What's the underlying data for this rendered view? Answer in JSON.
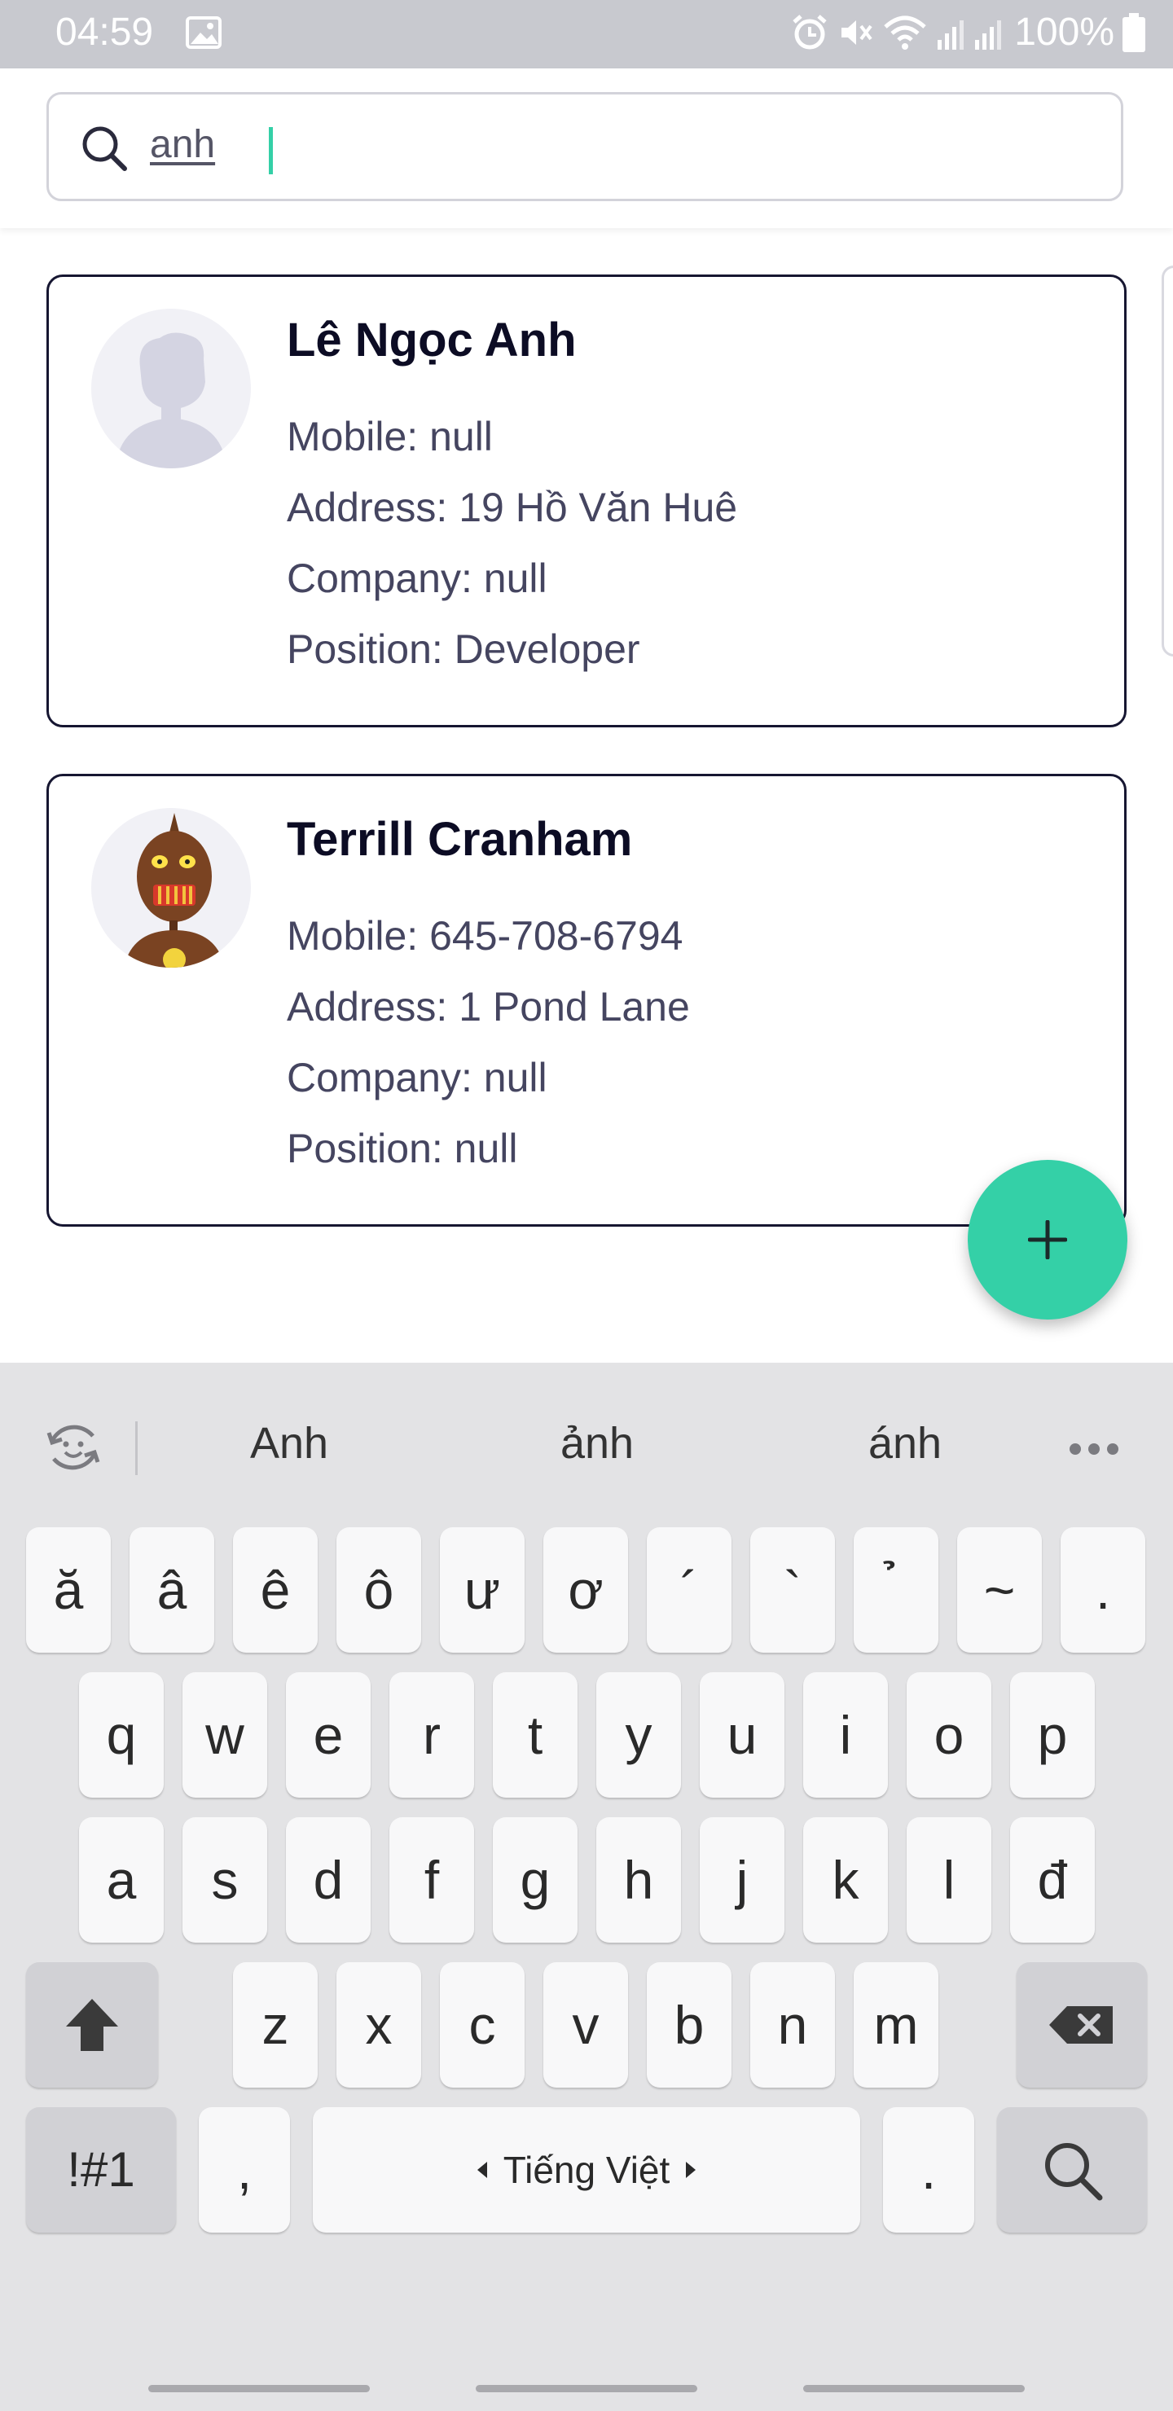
{
  "status_bar": {
    "time": "04:59",
    "battery": "100%",
    "icons": [
      "gallery-icon",
      "alarm-icon",
      "mute-icon",
      "wifi-icon",
      "signal-icon",
      "battery-icon"
    ]
  },
  "search": {
    "value": "anh",
    "icon": "search-icon"
  },
  "contacts": [
    {
      "name": "Lê Ngọc Anh",
      "mobile": "Mobile: null",
      "address": "Address: 19 Hồ Văn Huê",
      "company": "Company: null",
      "position": "Position: Developer",
      "avatar": "placeholder-person"
    },
    {
      "name": "Terrill Cranham",
      "mobile": "Mobile: 645-708-6794",
      "address": "Address: 1 Pond Lane",
      "company": "Company: null",
      "position": "Position: null",
      "avatar": "robot"
    }
  ],
  "fab": {
    "icon": "plus-icon"
  },
  "keyboard": {
    "suggestions": [
      "Anh",
      "ảnh",
      "ánh"
    ],
    "row0": [
      "ă",
      "â",
      "ê",
      "ô",
      "ư",
      "ơ",
      "´",
      "`",
      "̉",
      "~",
      "."
    ],
    "row1": [
      "q",
      "w",
      "e",
      "r",
      "t",
      "y",
      "u",
      "i",
      "o",
      "p"
    ],
    "row2": [
      "a",
      "s",
      "d",
      "f",
      "g",
      "h",
      "j",
      "k",
      "l",
      "đ"
    ],
    "row3": [
      "z",
      "x",
      "c",
      "v",
      "b",
      "n",
      "m"
    ],
    "symbols": "!#1",
    "comma": ",",
    "space": "Tiếng Việt",
    "period": "."
  },
  "colors": {
    "accent": "#34d0a7",
    "card_border": "#161631",
    "status_bar": "#c8c9cf"
  }
}
